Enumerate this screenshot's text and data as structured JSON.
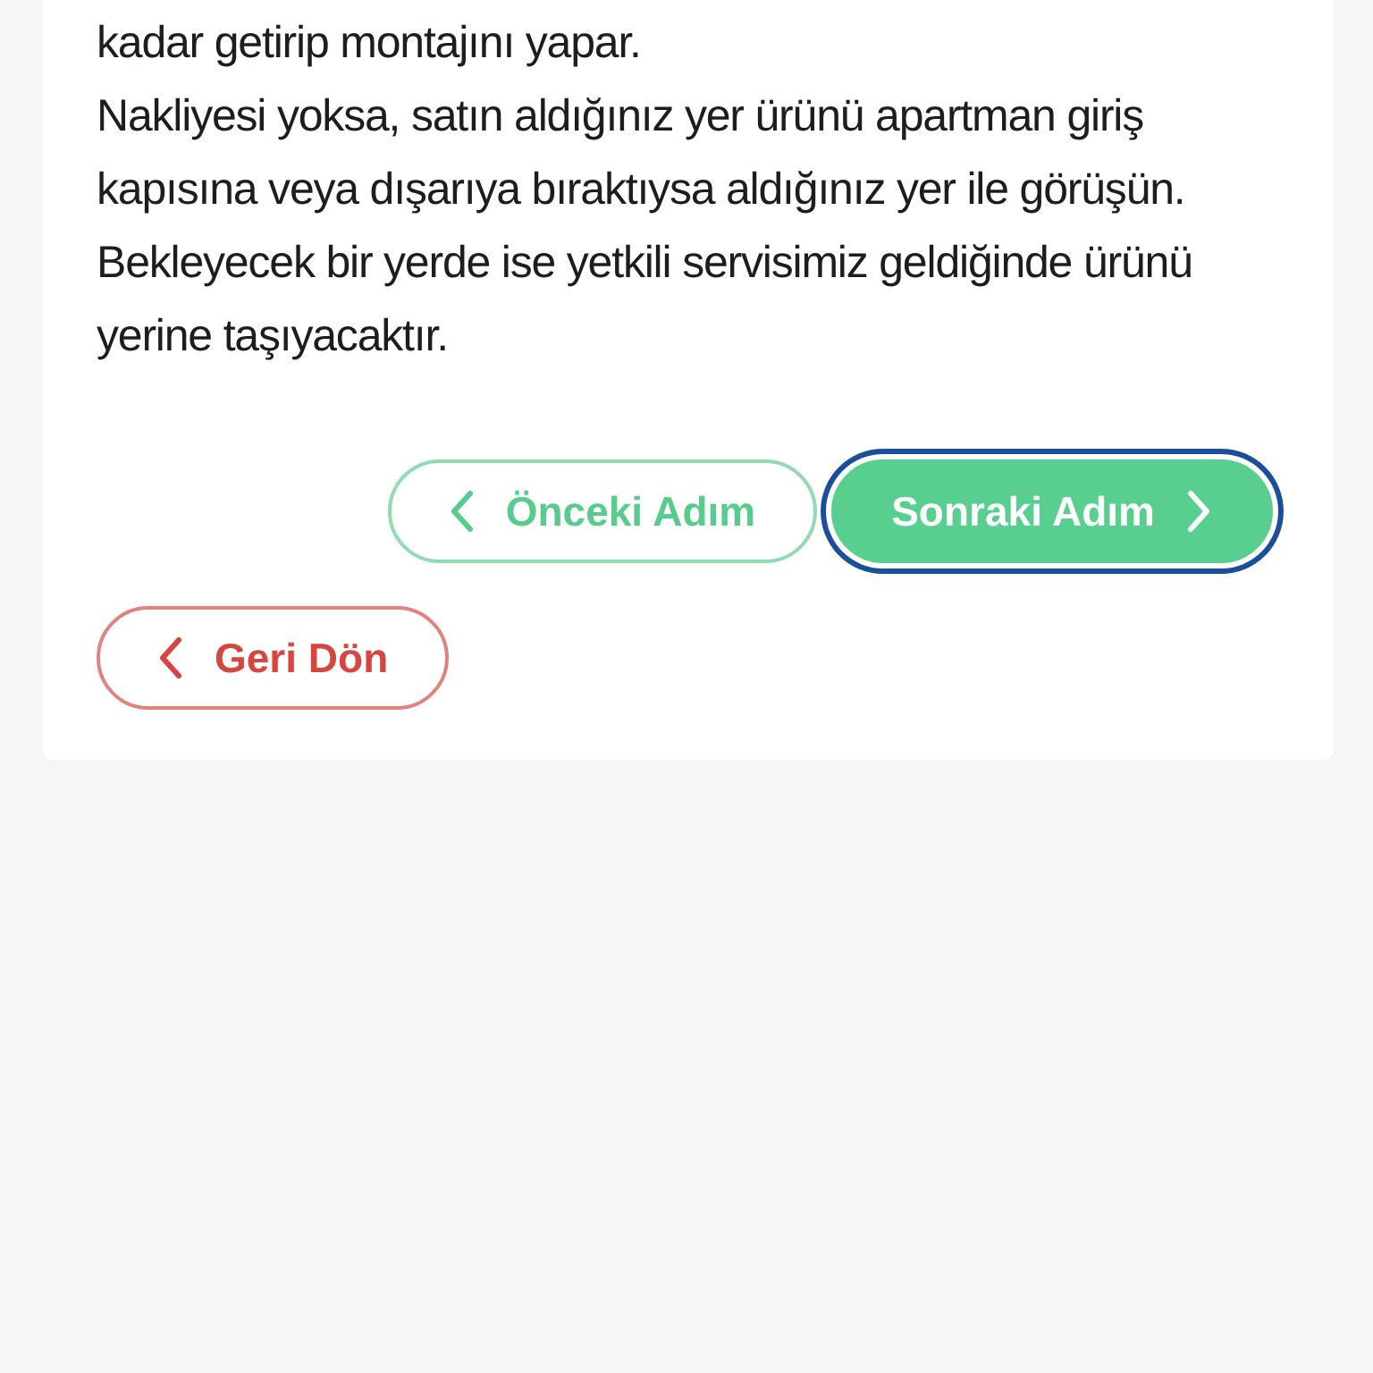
{
  "paragraphs": [
    "kadar getirip montajını yapar.",
    "Nakliyesi yoksa, satın aldığınız yer ürünü apartman giriş kapısına veya dışarıya bıraktıysa aldığınız yer ile görüşün. Bekleyecek bir yerde ise yetkili servisimiz geldiğinde ürünü yerine taşıyacaktır."
  ],
  "step_buttons": [
    {
      "label": "Önceki Adım",
      "kind": "previous",
      "focused": false
    },
    {
      "label": "Sonraki Adım",
      "kind": "next",
      "focused": true
    }
  ],
  "back_button": {
    "label": "Geri Dön"
  }
}
